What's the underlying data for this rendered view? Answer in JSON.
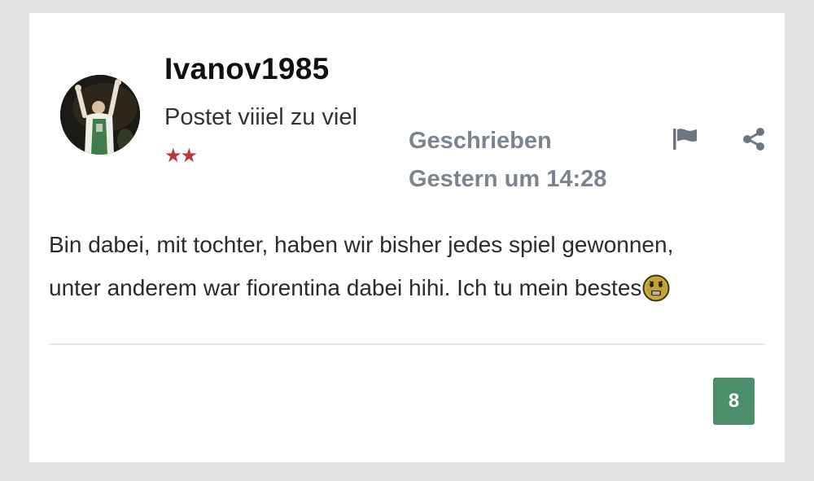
{
  "post": {
    "author": {
      "username": "Ivanov1985",
      "title": "Postet viiiel zu viel",
      "rank_stars": "★★"
    },
    "meta": {
      "written_label": "Geschrieben",
      "date": "Gestern um 14:28"
    },
    "body": {
      "line1": "Bin dabei, mit tochter, haben wir bisher jedes spiel gewonnen,",
      "line2": "unter anderem war fiorentina dabei hihi. Ich tu mein bestes"
    },
    "reaction_count": "8"
  },
  "colors": {
    "page_bg": "#e4e4e4",
    "card_bg": "#ffffff",
    "meta_text": "#7b8590",
    "icon": "#6b7682",
    "badge": "#4a8f6a",
    "star": "#b83a3a"
  },
  "icons": {
    "flag": "flag-icon",
    "share": "share-icon",
    "emoji": "nervous-face-emoji"
  }
}
